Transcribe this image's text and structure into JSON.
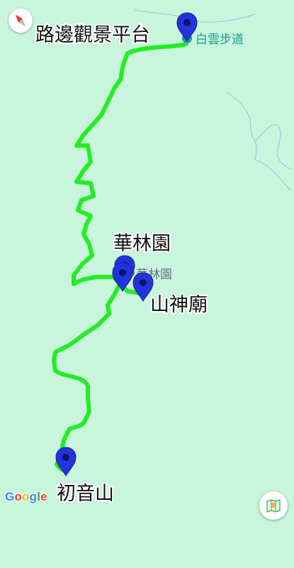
{
  "map": {
    "colors": {
      "background": "#c8f5dc",
      "route": "#22ee22",
      "marker": "#2233dd",
      "poi_text": "#1aa08f"
    },
    "labels": {
      "top_viewpoint": "路邊觀景平台",
      "hualin": "華林園",
      "shrine": "山神廟",
      "chuyin": "初音山"
    },
    "pois": {
      "baiyun_trail": "白雲步道",
      "hualin_poi": "華林園"
    },
    "markers": [
      "top-viewpoint",
      "hualin-a",
      "hualin-b",
      "shrine",
      "chuyin"
    ],
    "attribution": {
      "logo_letters": [
        "G",
        "o",
        "o",
        "g",
        "l",
        "e"
      ],
      "logo_colors": [
        "#4285F4",
        "#EA4335",
        "#FBBC05",
        "#4285F4",
        "#34A853",
        "#EA4335"
      ]
    },
    "controls": {
      "compass_icon": "compass-icon",
      "map_type_icon": "folded-map-icon"
    }
  }
}
